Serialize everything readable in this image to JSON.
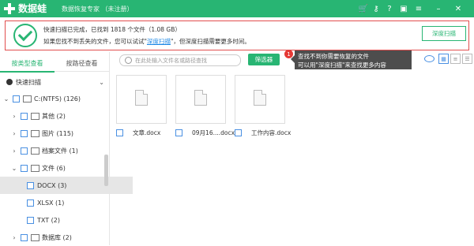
{
  "app": {
    "title": "数据蛙",
    "subtitle": "数据恢复专家 （未注册）"
  },
  "banner": {
    "line1": "快速扫描已完成，已找到 1818 个文件（1.08 GB）",
    "line2_pre": "如果您找不到丢失的文件，您可以试试\"",
    "line2_link": "深度扫描",
    "line2_post": "\"，但深度扫描需要更多时间。",
    "deep_scan_button": "深度扫描"
  },
  "sidebar": {
    "tabs": [
      "按类型查看",
      "按路径查看"
    ],
    "scan_mode": "快速扫描",
    "tree": [
      {
        "label": "C:(NTFS) (126)",
        "level": 0,
        "expanded": true
      },
      {
        "label": "其他 (2)",
        "level": 1,
        "expanded": false
      },
      {
        "label": "图片 (115)",
        "level": 1,
        "expanded": false
      },
      {
        "label": "档案文件 (1)",
        "level": 1,
        "expanded": false
      },
      {
        "label": "文件 (6)",
        "level": 1,
        "expanded": true
      },
      {
        "label": "DOCX (3)",
        "level": 2,
        "selected": true
      },
      {
        "label": "XLSX (1)",
        "level": 2
      },
      {
        "label": "TXT (2)",
        "level": 2
      },
      {
        "label": "数据库 (2)",
        "level": 1,
        "expanded": false
      }
    ]
  },
  "toolbar": {
    "search_placeholder": "在此处输入文件名或路径查找",
    "filter_button": "筛选器",
    "badge": "1",
    "tooltip_line1": "查找不到你需要恢复的文件",
    "tooltip_line2": "可以用\"深度扫描\"来查找更多内容"
  },
  "files": [
    {
      "name": "文章.docx"
    },
    {
      "name": "09月16....docx"
    },
    {
      "name": "工作内容.docx"
    }
  ],
  "colors": {
    "brand": "#28b573",
    "alert": "#e14e4e",
    "link": "#1e88e5"
  }
}
